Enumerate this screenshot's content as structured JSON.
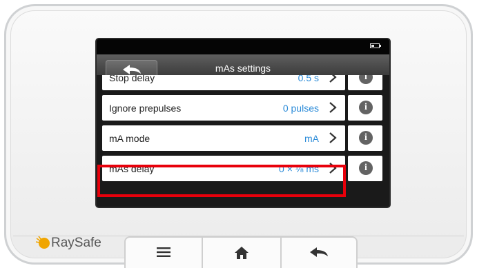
{
  "screen": {
    "title": "mAs settings",
    "rows": [
      {
        "label": "Stop delay",
        "value": "0.5 s"
      },
      {
        "label": "Ignore prepulses",
        "value": "0 pulses"
      },
      {
        "label": "mA mode",
        "value": "mA"
      },
      {
        "label": "mAs delay",
        "value": "0 × ⅛ ms"
      }
    ],
    "highlighted_row": "mAs delay",
    "info_icon_glyph": "i"
  },
  "brand": {
    "name": "RaySafe"
  },
  "icons": {
    "battery": "battery-icon",
    "back": "back-arrow-icon",
    "chevron": "chevron-right-icon",
    "info": "info-icon",
    "menu": "menu-icon",
    "home": "home-icon"
  },
  "colors": {
    "value_text": "#2b8bd8",
    "highlight_border": "#e8000b",
    "brand_logo": "#f0a500"
  }
}
